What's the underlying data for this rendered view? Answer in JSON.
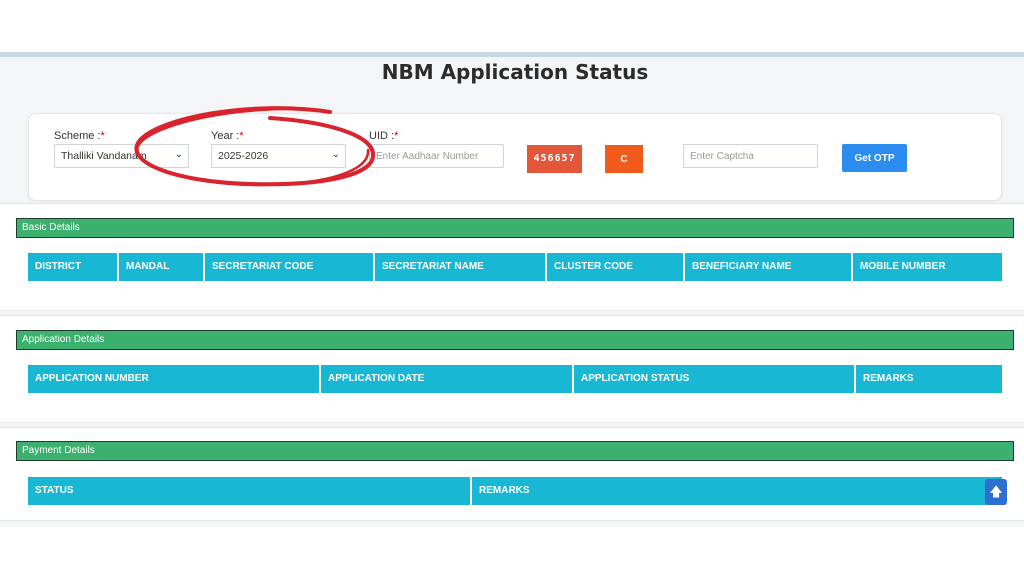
{
  "page": {
    "title": "NBM Application Status"
  },
  "form": {
    "scheme": {
      "label": "Scheme :",
      "required_mark": "*",
      "value": "Thalliki Vandanam"
    },
    "year": {
      "label": "Year :",
      "required_mark": "*",
      "value": "2025-2026"
    },
    "uid": {
      "label": "UID :",
      "required_mark": "*",
      "placeholder": "Enter Aadhaar Number"
    },
    "captcha_code": "456657",
    "refresh_label": "C",
    "captcha_input": {
      "placeholder": "Enter Captcha"
    },
    "get_otp_label": "Get OTP"
  },
  "basic_details": {
    "heading": "Basic Details",
    "columns": [
      "DISTRICT",
      "MANDAL",
      "SECRETARIAT CODE",
      "SECRETARIAT NAME",
      "CLUSTER CODE",
      "BENEFICIARY NAME",
      "MOBILE NUMBER"
    ]
  },
  "application_details": {
    "heading": "Application Details",
    "columns": [
      "APPLICATION NUMBER",
      "APPLICATION DATE",
      "APPLICATION STATUS",
      "REMARKS"
    ]
  },
  "payment_details": {
    "heading": "Payment Details",
    "columns": [
      "STATUS",
      "REMARKS"
    ]
  },
  "icons": {
    "scroll_top": "arrow-up-icon",
    "dropdown": "chevron-down-icon",
    "refresh": "refresh-icon"
  },
  "colors": {
    "section_header": "#3cb06e",
    "table_header": "#18b8d4",
    "captcha_bg": "#e2573a",
    "refresh_bg": "#f05a1a",
    "otp_button": "#2d8cf0",
    "annotation": "#d9232d"
  },
  "annotation": "red-circle-around-year-dropdown"
}
